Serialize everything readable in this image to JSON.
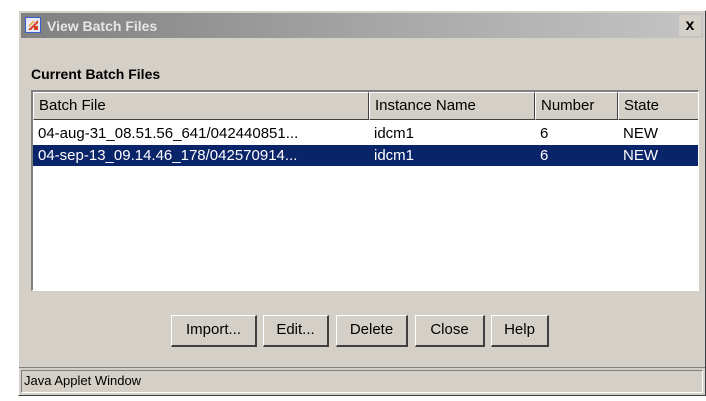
{
  "window": {
    "title": "View Batch Files",
    "title_icon": "java-cup-icon",
    "close_label": "x"
  },
  "section_label": "Current Batch Files",
  "table": {
    "columns": [
      "Batch File",
      "Instance Name",
      "Number",
      "State"
    ],
    "rows": [
      {
        "batch_file": "04-aug-31_08.51.56_641/042440851...",
        "instance_name": "idcm1",
        "number": "6",
        "state": "NEW",
        "selected": false
      },
      {
        "batch_file": "04-sep-13_09.14.46_178/042570914...",
        "instance_name": "idcm1",
        "number": "6",
        "state": "NEW",
        "selected": true
      }
    ]
  },
  "buttons": {
    "import": "Import...",
    "edit": "Edit...",
    "delete": "Delete",
    "close": "Close",
    "help": "Help"
  },
  "status_bar": "Java Applet Window",
  "colors": {
    "selection": "#0a246a",
    "window_bg": "#d4d0c8"
  }
}
